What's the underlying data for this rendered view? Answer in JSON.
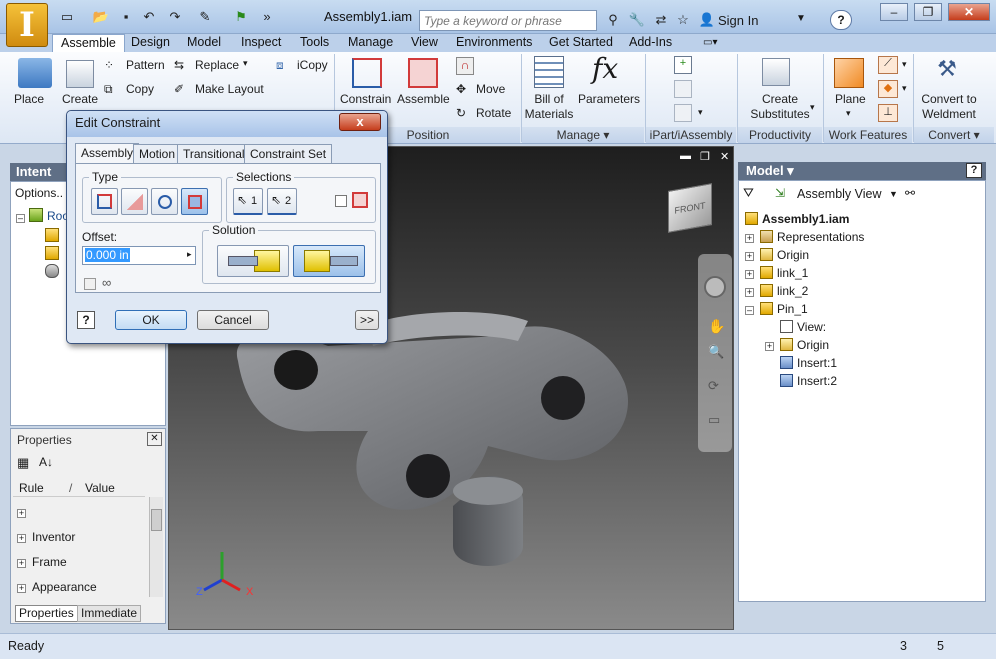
{
  "app": {
    "logo": "I",
    "doc_title": "Assembly1.iam",
    "search_placeholder": "Type a keyword or phrase",
    "sign_in": "Sign In",
    "help": "?"
  },
  "ribbon_tabs": [
    "Assemble",
    "Design",
    "Model",
    "Inspect",
    "Tools",
    "Manage",
    "View",
    "Environments",
    "Get Started",
    "Add-Ins"
  ],
  "ribbon": {
    "component": {
      "place": "Place",
      "create": "Create",
      "pattern": "Pattern",
      "copy": "Copy",
      "replace": "Replace",
      "make_layout": "Make Layout",
      "icopy": "iCopy"
    },
    "position": {
      "constrain": "Constrain",
      "assemble": "Assemble",
      "move": "Move",
      "rotate": "Rotate",
      "title": "Position"
    },
    "manage": {
      "bom": "Bill of Materials",
      "parameters": "Parameters",
      "title": "Manage"
    },
    "ipart": {
      "title": "iPart/iAssembly"
    },
    "productivity": {
      "create_substitutes": "Create Substitutes",
      "title": "Productivity"
    },
    "work_features": {
      "plane": "Plane",
      "title": "Work Features"
    },
    "convert": {
      "convert_weldment": "Convert to Weldment",
      "title": "Convert"
    }
  },
  "left_browser": {
    "header": "Intent",
    "options": "Options..",
    "root": "Roo"
  },
  "properties": {
    "title": "Properties",
    "col_rule": "Rule",
    "col_sep": "/",
    "col_value": "Value",
    "rows": [
      "",
      "Inventor",
      "Frame",
      "Appearance"
    ],
    "tabs": [
      "Properties",
      "Immediate"
    ]
  },
  "model_browser": {
    "header": "Model",
    "view": "Assembly View",
    "root": "Assembly1.iam",
    "items": [
      {
        "label": "Representations",
        "indent": 0,
        "plus": true
      },
      {
        "label": "Origin",
        "indent": 0,
        "plus": true
      },
      {
        "label": "link_1",
        "indent": 0,
        "plus": true
      },
      {
        "label": "link_2",
        "indent": 0,
        "plus": true
      },
      {
        "label": "Pin_1",
        "indent": 0,
        "plus": true
      },
      {
        "label": "View:",
        "indent": 1,
        "plus": false
      },
      {
        "label": "Origin",
        "indent": 1,
        "plus": true
      },
      {
        "label": "Insert:1",
        "indent": 1,
        "plus": false
      },
      {
        "label": "Insert:2",
        "indent": 1,
        "plus": false
      }
    ]
  },
  "viewcube": {
    "face": "FRONT"
  },
  "axes": {
    "z": "Z",
    "x": "X"
  },
  "dialog": {
    "title": "Edit Constraint",
    "close": "x",
    "tabs": [
      "Assembly",
      "Motion",
      "Transitional",
      "Constraint Set"
    ],
    "type_label": "Type",
    "selections_label": "Selections",
    "sel1": "1",
    "sel2": "2",
    "offset_label": "Offset:",
    "offset_value": "0.000 in",
    "solution_label": "Solution",
    "help": "?",
    "ok": "OK",
    "cancel": "Cancel",
    "more": ">>"
  },
  "status": {
    "text": "Ready",
    "num1": "3",
    "num2": "5"
  }
}
